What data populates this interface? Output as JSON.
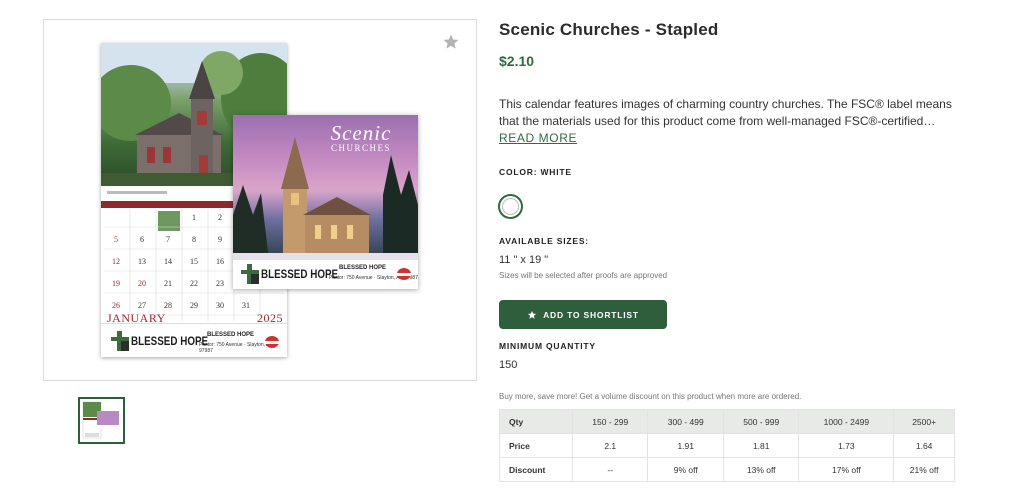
{
  "product": {
    "title": "Scenic Churches - Stapled",
    "price": "$2.10",
    "description": "This calendar features images of charming country churches. The FSC® label means that the materials used for this product come from well-managed FSC®-certified…",
    "read_more": "READ MORE"
  },
  "color": {
    "label": "COLOR: WHITE",
    "swatch_color": "#ffffff"
  },
  "sizes": {
    "label": "AVAILABLE SIZES:",
    "value": "11 \" x 19 \"",
    "note": "Sizes will be selected after proofs are approved"
  },
  "shortlist": {
    "label": "ADD TO SHORTLIST",
    "icon": "star-icon"
  },
  "min_qty": {
    "label": "MINIMUM QUANTITY",
    "value": "150"
  },
  "promo": "Buy more, save more! Get a volume discount on this product when more are ordered.",
  "pricing_table": {
    "headers": [
      "Qty",
      "150 - 299",
      "300 - 499",
      "500 - 999",
      "1000 - 2499",
      "2500+"
    ],
    "rows": [
      {
        "label": "Price",
        "cells": [
          "2.1",
          "1.91",
          "1.81",
          "1.73",
          "1.64"
        ]
      },
      {
        "label": "Discount",
        "cells": [
          "--",
          "9% off",
          "13% off",
          "17% off",
          "21% off"
        ]
      }
    ]
  },
  "artwork": {
    "scenic_title": "Scenic",
    "churches_title": "CHURCHES",
    "month": "JANUARY",
    "year": "2025",
    "advertiser": "BLESSED HOPE",
    "advertiser_small": "BLESSED HOPE",
    "advertiser_sub": "Pastor: 750 Avenue · Slayton, AZ 97987",
    "day_numbers": [
      "1",
      "2",
      "5",
      "6",
      "7",
      "8",
      "9",
      "12",
      "13",
      "14",
      "15",
      "16",
      "19",
      "20",
      "21",
      "22",
      "23",
      "26",
      "27",
      "28",
      "29",
      "30",
      "31"
    ]
  },
  "colors": {
    "accent_green": "#2f6b3f",
    "button_green": "#2f5e3c",
    "calendar_red": "#a3282b"
  }
}
